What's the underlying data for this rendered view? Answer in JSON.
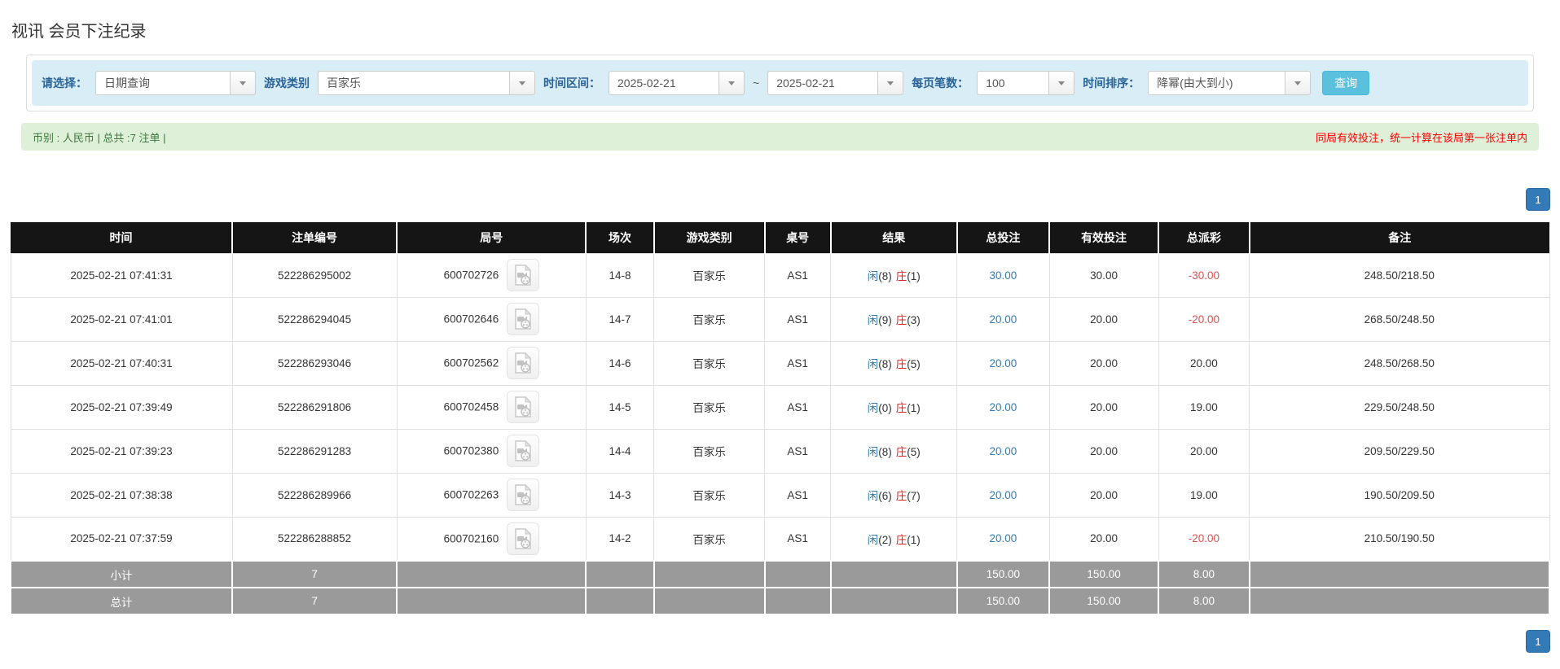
{
  "page": {
    "title": "视讯 会员下注纪录"
  },
  "filters": {
    "select_label": "请选择：",
    "select_value": "日期查询",
    "game_type_label": "游戏类别",
    "game_type_value": "百家乐",
    "date_range_label": "时间区间：",
    "date_from": "2025-02-21",
    "date_separator": "~",
    "date_to": "2025-02-21",
    "page_size_label": "每页笔数：",
    "page_size_value": "100",
    "sort_label": "时间排序：",
    "sort_value": "降幂(由大到小)",
    "search_button": "查询"
  },
  "summary": {
    "left_text": "币别 : 人民币 | 总共 :7 注单 |",
    "right_text": "同局有效投注，统一计算在该局第一张注单内"
  },
  "pagination": {
    "page": "1"
  },
  "icons": {
    "combo_caret": "chevron-down",
    "round_cell_icon": "video-file"
  },
  "colors": {
    "filter_bar_bg": "#d9edf7",
    "filter_label": "#2a6496",
    "search_button_bg": "#5bc0de",
    "summary_bg": "#dff0d8",
    "summary_text": "#3c763d",
    "summary_warning": "#ff0000",
    "table_header_bg": "#151515",
    "table_footer_bg": "#9a9a9a",
    "link_blue": "#337ab7",
    "negative_red": "#d9534f",
    "banker_red": "#e01e1e",
    "pagination_bg": "#337ab7"
  },
  "table": {
    "headers": [
      "时间",
      "注单编号",
      "局号",
      "场次",
      "游戏类别",
      "桌号",
      "结果",
      "总投注",
      "有效投注",
      "总派彩",
      "备注"
    ],
    "rows": [
      {
        "time": "2025-02-21 07:41:31",
        "bet_id": "522286295002",
        "round_id": "600702726",
        "session": "14-8",
        "game": "百家乐",
        "table_no": "AS1",
        "player_label": "闲",
        "player_paren": "(8)",
        "banker_label": "庄",
        "banker_paren": "(1)",
        "total_bet": "30.00",
        "valid_bet": "30.00",
        "payout": "-30.00",
        "remark": "248.50/218.50"
      },
      {
        "time": "2025-02-21 07:41:01",
        "bet_id": "522286294045",
        "round_id": "600702646",
        "session": "14-7",
        "game": "百家乐",
        "table_no": "AS1",
        "player_label": "闲",
        "player_paren": "(9)",
        "banker_label": "庄",
        "banker_paren": "(3)",
        "total_bet": "20.00",
        "valid_bet": "20.00",
        "payout": "-20.00",
        "remark": "268.50/248.50"
      },
      {
        "time": "2025-02-21 07:40:31",
        "bet_id": "522286293046",
        "round_id": "600702562",
        "session": "14-6",
        "game": "百家乐",
        "table_no": "AS1",
        "player_label": "闲",
        "player_paren": "(8)",
        "banker_label": "庄",
        "banker_paren": "(5)",
        "total_bet": "20.00",
        "valid_bet": "20.00",
        "payout": "20.00",
        "remark": "248.50/268.50"
      },
      {
        "time": "2025-02-21 07:39:49",
        "bet_id": "522286291806",
        "round_id": "600702458",
        "session": "14-5",
        "game": "百家乐",
        "table_no": "AS1",
        "player_label": "闲",
        "player_paren": "(0)",
        "banker_label": "庄",
        "banker_paren": "(1)",
        "total_bet": "20.00",
        "valid_bet": "20.00",
        "payout": "19.00",
        "remark": "229.50/248.50"
      },
      {
        "time": "2025-02-21 07:39:23",
        "bet_id": "522286291283",
        "round_id": "600702380",
        "session": "14-4",
        "game": "百家乐",
        "table_no": "AS1",
        "player_label": "闲",
        "player_paren": "(8)",
        "banker_label": "庄",
        "banker_paren": "(5)",
        "total_bet": "20.00",
        "valid_bet": "20.00",
        "payout": "20.00",
        "remark": "209.50/229.50"
      },
      {
        "time": "2025-02-21 07:38:38",
        "bet_id": "522286289966",
        "round_id": "600702263",
        "session": "14-3",
        "game": "百家乐",
        "table_no": "AS1",
        "player_label": "闲",
        "player_paren": "(6)",
        "banker_label": "庄",
        "banker_paren": "(7)",
        "total_bet": "20.00",
        "valid_bet": "20.00",
        "payout": "19.00",
        "remark": "190.50/209.50"
      },
      {
        "time": "2025-02-21 07:37:59",
        "bet_id": "522286288852",
        "round_id": "600702160",
        "session": "14-2",
        "game": "百家乐",
        "table_no": "AS1",
        "player_label": "闲",
        "player_paren": "(2)",
        "banker_label": "庄",
        "banker_paren": "(1)",
        "total_bet": "20.00",
        "valid_bet": "20.00",
        "payout": "-20.00",
        "remark": "210.50/190.50"
      }
    ],
    "footer_rows": [
      {
        "label": "小计",
        "count": "7",
        "total_bet": "150.00",
        "valid_bet": "150.00",
        "payout": "8.00"
      },
      {
        "label": "总计",
        "count": "7",
        "total_bet": "150.00",
        "valid_bet": "150.00",
        "payout": "8.00"
      }
    ]
  }
}
